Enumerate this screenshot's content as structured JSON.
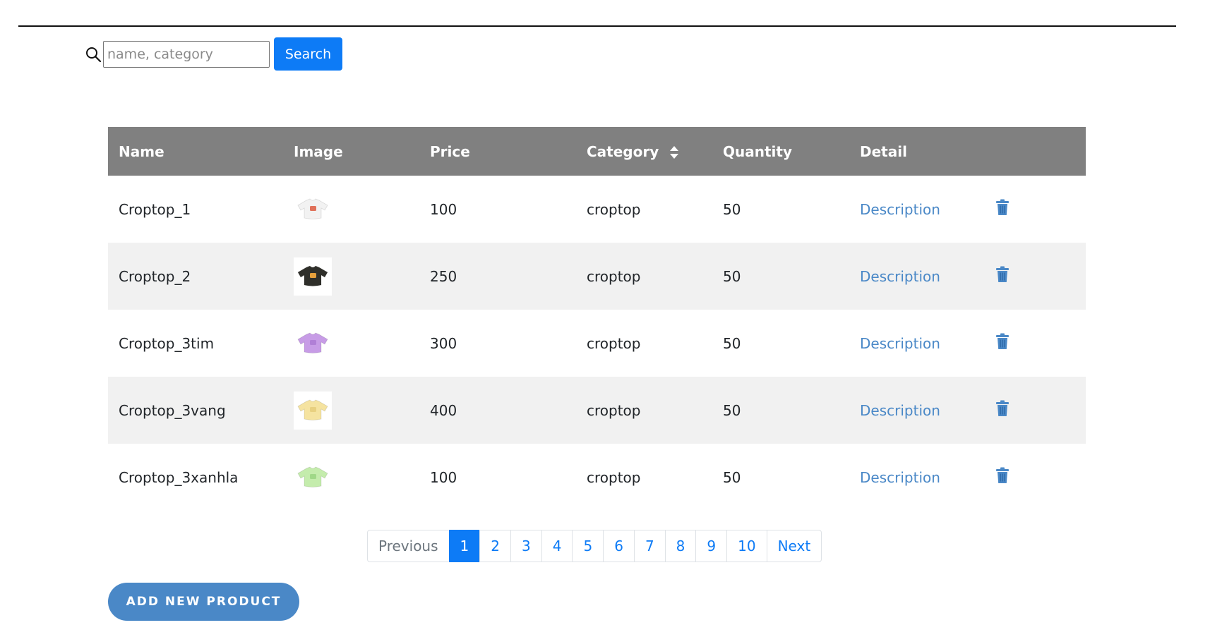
{
  "search": {
    "placeholder": "name, category",
    "button_label": "Search"
  },
  "table": {
    "headers": {
      "name": "Name",
      "image": "Image",
      "price": "Price",
      "category": "Category",
      "quantity": "Quantity",
      "detail": "Detail"
    },
    "rows": [
      {
        "name": "Croptop_1",
        "price": "100",
        "category": "croptop",
        "quantity": "50",
        "detail": "Description",
        "shirt_color": "#f2f2f2",
        "print_color": "#e0715a"
      },
      {
        "name": "Croptop_2",
        "price": "250",
        "category": "croptop",
        "quantity": "50",
        "detail": "Description",
        "shirt_color": "#2f2f2a",
        "print_color": "#e6a03c"
      },
      {
        "name": "Croptop_3tim",
        "price": "300",
        "category": "croptop",
        "quantity": "50",
        "detail": "Description",
        "shirt_color": "#c79ce6",
        "print_color": "#b07fd6"
      },
      {
        "name": "Croptop_3vang",
        "price": "400",
        "category": "croptop",
        "quantity": "50",
        "detail": "Description",
        "shirt_color": "#f5e3a0",
        "print_color": "#e8d080"
      },
      {
        "name": "Croptop_3xanhla",
        "price": "100",
        "category": "croptop",
        "quantity": "50",
        "detail": "Description",
        "shirt_color": "#c4ecac",
        "print_color": "#a0d888"
      }
    ]
  },
  "pagination": {
    "previous": "Previous",
    "pages": [
      "1",
      "2",
      "3",
      "4",
      "5",
      "6",
      "7",
      "8",
      "9",
      "10"
    ],
    "active": "1",
    "next": "Next"
  },
  "add_button_label": "ADD NEW PRODUCT",
  "colors": {
    "primary": "#0d7bf6",
    "header_bg": "#808080",
    "link": "#4a88c7",
    "alt_row": "#f1f1f1"
  },
  "icons": {
    "search": "search-icon",
    "sort": "sort-icon",
    "delete": "trash-icon"
  }
}
